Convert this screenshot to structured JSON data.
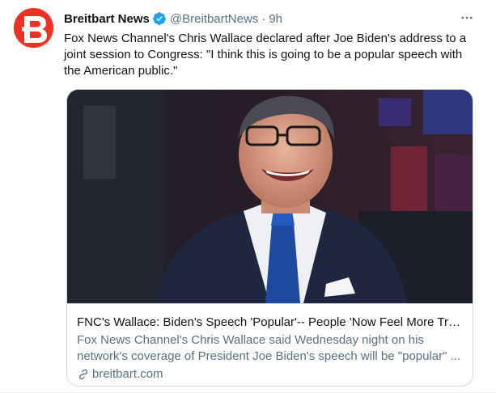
{
  "tweet": {
    "author_name": "Breitbart News",
    "handle": "@BreitbartNews",
    "separator": "·",
    "time": "9h",
    "more_label": "•••",
    "text": "Fox News Channel's Chris Wallace declared after Joe Biden's address to a joint session to Congress: \"I think this is going to be a popular speech with the American public.\""
  },
  "card": {
    "title": "FNC's Wallace: Biden's Speech 'Popular'-- People 'Now Feel More Trust...",
    "description": "Fox News Channel's Chris Wallace said Wednesday night on his network's coverage of President Joe Biden's speech will be \"popular\" ...",
    "domain": "breitbart.com"
  },
  "colors": {
    "brand_red": "#ee3124",
    "verified_blue": "#1da1f2",
    "secondary_text": "#5b7083"
  },
  "icons": {
    "avatar": "breitbart-logo",
    "verified": "verified-badge-icon",
    "more": "more-icon",
    "link": "link-icon"
  }
}
